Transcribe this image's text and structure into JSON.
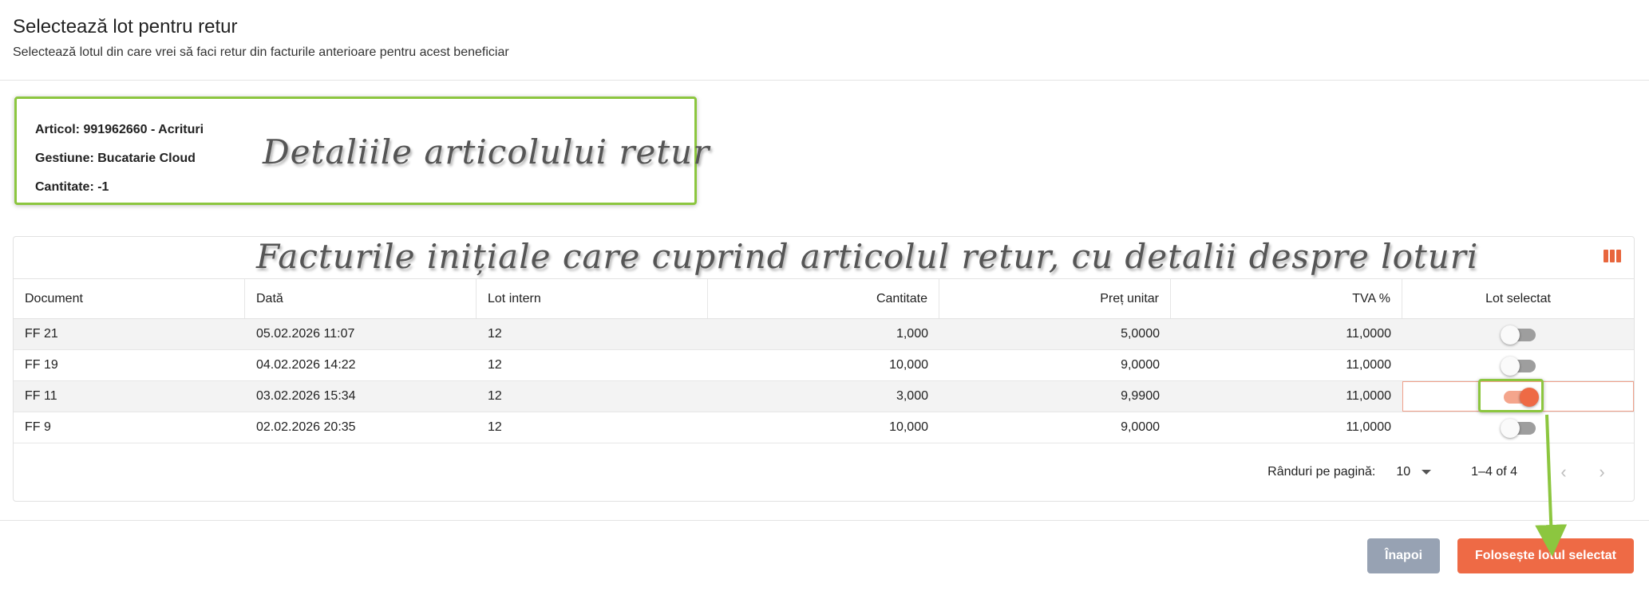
{
  "dialog": {
    "title": "Selectează lot pentru retur",
    "subtitle": "Selectează lotul din care vrei să faci retur din facturile anterioare pentru acest beneficiar"
  },
  "details": {
    "article": "Articol: 991962660 - Acrituri",
    "warehouse": "Gestiune: Bucatarie Cloud",
    "quantity": "Cantitate: -1"
  },
  "annotations": {
    "details": "Detaliile articolului retur",
    "table": "Facturile inițiale care cuprind articolul retur, cu detalii despre loturi"
  },
  "table": {
    "columns": [
      "Document",
      "Dată",
      "Lot intern",
      "Cantitate",
      "Preț unitar",
      "TVA %",
      "Lot selectat"
    ],
    "rows": [
      {
        "document": "FF 21",
        "date": "05.02.2026 11:07",
        "lot": "12",
        "quantity": "1,000",
        "price": "5,0000",
        "vat": "11,0000",
        "selected": false
      },
      {
        "document": "FF 19",
        "date": "04.02.2026 14:22",
        "lot": "12",
        "quantity": "10,000",
        "price": "9,0000",
        "vat": "11,0000",
        "selected": false
      },
      {
        "document": "FF 11",
        "date": "03.02.2026 15:34",
        "lot": "12",
        "quantity": "3,000",
        "price": "9,9900",
        "vat": "11,0000",
        "selected": true
      },
      {
        "document": "FF 9",
        "date": "02.02.2026 20:35",
        "lot": "12",
        "quantity": "10,000",
        "price": "9,0000",
        "vat": "11,0000",
        "selected": false
      }
    ],
    "columns_icon": "view-columns-icon"
  },
  "pagination": {
    "rows_per_page_label": "Rânduri pe pagină:",
    "rows_per_page_value": "10",
    "range": "1–4 of 4",
    "prev_icon": "chevron-left-icon",
    "next_icon": "chevron-right-icon"
  },
  "footer": {
    "back_label": "Înapoi",
    "use_label": "Folosește lotul selectat"
  },
  "colors": {
    "accent": "#ee6a45",
    "annotation_frame": "#8cc63f",
    "back_button": "#97a2b3"
  }
}
